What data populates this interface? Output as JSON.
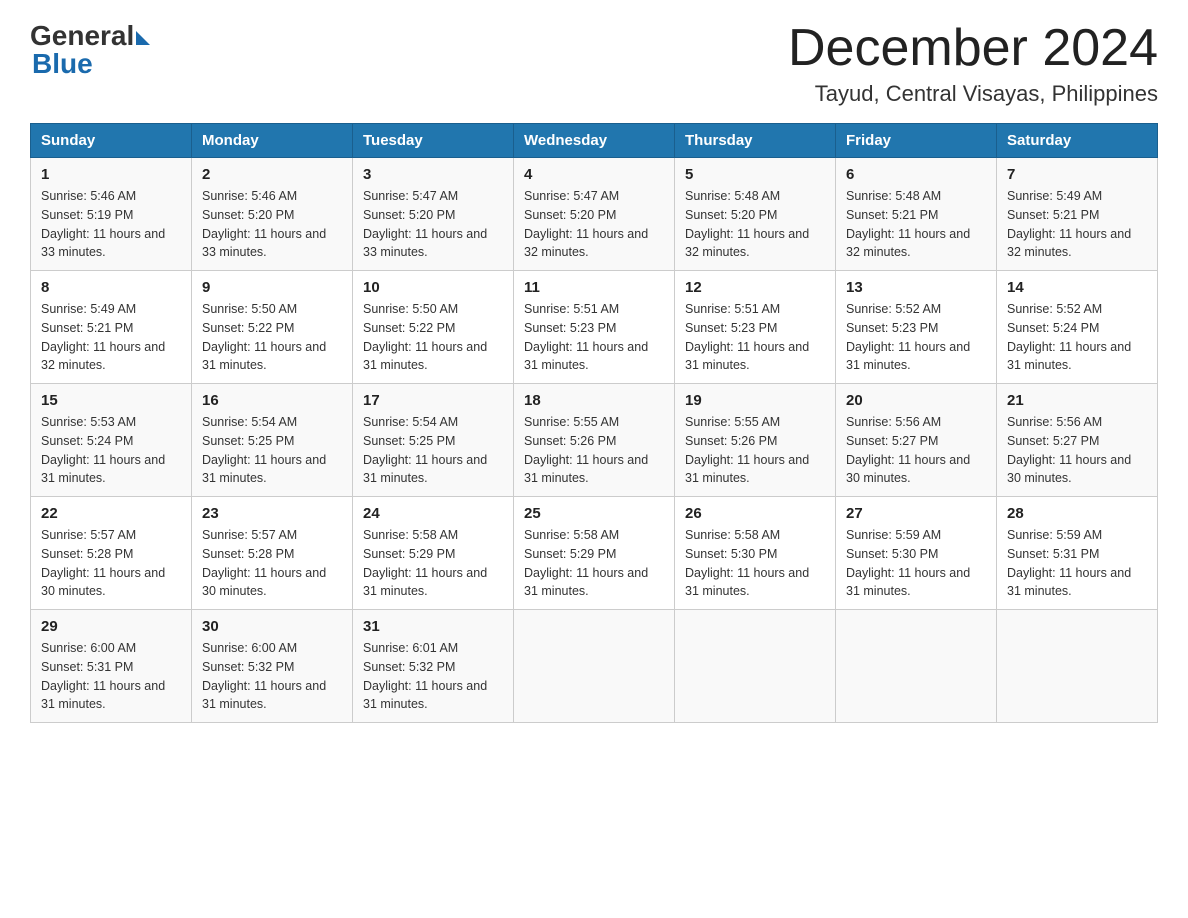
{
  "logo": {
    "text_general": "General",
    "text_blue": "Blue"
  },
  "header": {
    "month": "December 2024",
    "location": "Tayud, Central Visayas, Philippines"
  },
  "days_of_week": [
    "Sunday",
    "Monday",
    "Tuesday",
    "Wednesday",
    "Thursday",
    "Friday",
    "Saturday"
  ],
  "weeks": [
    [
      {
        "day": "1",
        "sunrise": "5:46 AM",
        "sunset": "5:19 PM",
        "daylight": "11 hours and 33 minutes."
      },
      {
        "day": "2",
        "sunrise": "5:46 AM",
        "sunset": "5:20 PM",
        "daylight": "11 hours and 33 minutes."
      },
      {
        "day": "3",
        "sunrise": "5:47 AM",
        "sunset": "5:20 PM",
        "daylight": "11 hours and 33 minutes."
      },
      {
        "day": "4",
        "sunrise": "5:47 AM",
        "sunset": "5:20 PM",
        "daylight": "11 hours and 32 minutes."
      },
      {
        "day": "5",
        "sunrise": "5:48 AM",
        "sunset": "5:20 PM",
        "daylight": "11 hours and 32 minutes."
      },
      {
        "day": "6",
        "sunrise": "5:48 AM",
        "sunset": "5:21 PM",
        "daylight": "11 hours and 32 minutes."
      },
      {
        "day": "7",
        "sunrise": "5:49 AM",
        "sunset": "5:21 PM",
        "daylight": "11 hours and 32 minutes."
      }
    ],
    [
      {
        "day": "8",
        "sunrise": "5:49 AM",
        "sunset": "5:21 PM",
        "daylight": "11 hours and 32 minutes."
      },
      {
        "day": "9",
        "sunrise": "5:50 AM",
        "sunset": "5:22 PM",
        "daylight": "11 hours and 31 minutes."
      },
      {
        "day": "10",
        "sunrise": "5:50 AM",
        "sunset": "5:22 PM",
        "daylight": "11 hours and 31 minutes."
      },
      {
        "day": "11",
        "sunrise": "5:51 AM",
        "sunset": "5:23 PM",
        "daylight": "11 hours and 31 minutes."
      },
      {
        "day": "12",
        "sunrise": "5:51 AM",
        "sunset": "5:23 PM",
        "daylight": "11 hours and 31 minutes."
      },
      {
        "day": "13",
        "sunrise": "5:52 AM",
        "sunset": "5:23 PM",
        "daylight": "11 hours and 31 minutes."
      },
      {
        "day": "14",
        "sunrise": "5:52 AM",
        "sunset": "5:24 PM",
        "daylight": "11 hours and 31 minutes."
      }
    ],
    [
      {
        "day": "15",
        "sunrise": "5:53 AM",
        "sunset": "5:24 PM",
        "daylight": "11 hours and 31 minutes."
      },
      {
        "day": "16",
        "sunrise": "5:54 AM",
        "sunset": "5:25 PM",
        "daylight": "11 hours and 31 minutes."
      },
      {
        "day": "17",
        "sunrise": "5:54 AM",
        "sunset": "5:25 PM",
        "daylight": "11 hours and 31 minutes."
      },
      {
        "day": "18",
        "sunrise": "5:55 AM",
        "sunset": "5:26 PM",
        "daylight": "11 hours and 31 minutes."
      },
      {
        "day": "19",
        "sunrise": "5:55 AM",
        "sunset": "5:26 PM",
        "daylight": "11 hours and 31 minutes."
      },
      {
        "day": "20",
        "sunrise": "5:56 AM",
        "sunset": "5:27 PM",
        "daylight": "11 hours and 30 minutes."
      },
      {
        "day": "21",
        "sunrise": "5:56 AM",
        "sunset": "5:27 PM",
        "daylight": "11 hours and 30 minutes."
      }
    ],
    [
      {
        "day": "22",
        "sunrise": "5:57 AM",
        "sunset": "5:28 PM",
        "daylight": "11 hours and 30 minutes."
      },
      {
        "day": "23",
        "sunrise": "5:57 AM",
        "sunset": "5:28 PM",
        "daylight": "11 hours and 30 minutes."
      },
      {
        "day": "24",
        "sunrise": "5:58 AM",
        "sunset": "5:29 PM",
        "daylight": "11 hours and 31 minutes."
      },
      {
        "day": "25",
        "sunrise": "5:58 AM",
        "sunset": "5:29 PM",
        "daylight": "11 hours and 31 minutes."
      },
      {
        "day": "26",
        "sunrise": "5:58 AM",
        "sunset": "5:30 PM",
        "daylight": "11 hours and 31 minutes."
      },
      {
        "day": "27",
        "sunrise": "5:59 AM",
        "sunset": "5:30 PM",
        "daylight": "11 hours and 31 minutes."
      },
      {
        "day": "28",
        "sunrise": "5:59 AM",
        "sunset": "5:31 PM",
        "daylight": "11 hours and 31 minutes."
      }
    ],
    [
      {
        "day": "29",
        "sunrise": "6:00 AM",
        "sunset": "5:31 PM",
        "daylight": "11 hours and 31 minutes."
      },
      {
        "day": "30",
        "sunrise": "6:00 AM",
        "sunset": "5:32 PM",
        "daylight": "11 hours and 31 minutes."
      },
      {
        "day": "31",
        "sunrise": "6:01 AM",
        "sunset": "5:32 PM",
        "daylight": "11 hours and 31 minutes."
      },
      null,
      null,
      null,
      null
    ]
  ]
}
